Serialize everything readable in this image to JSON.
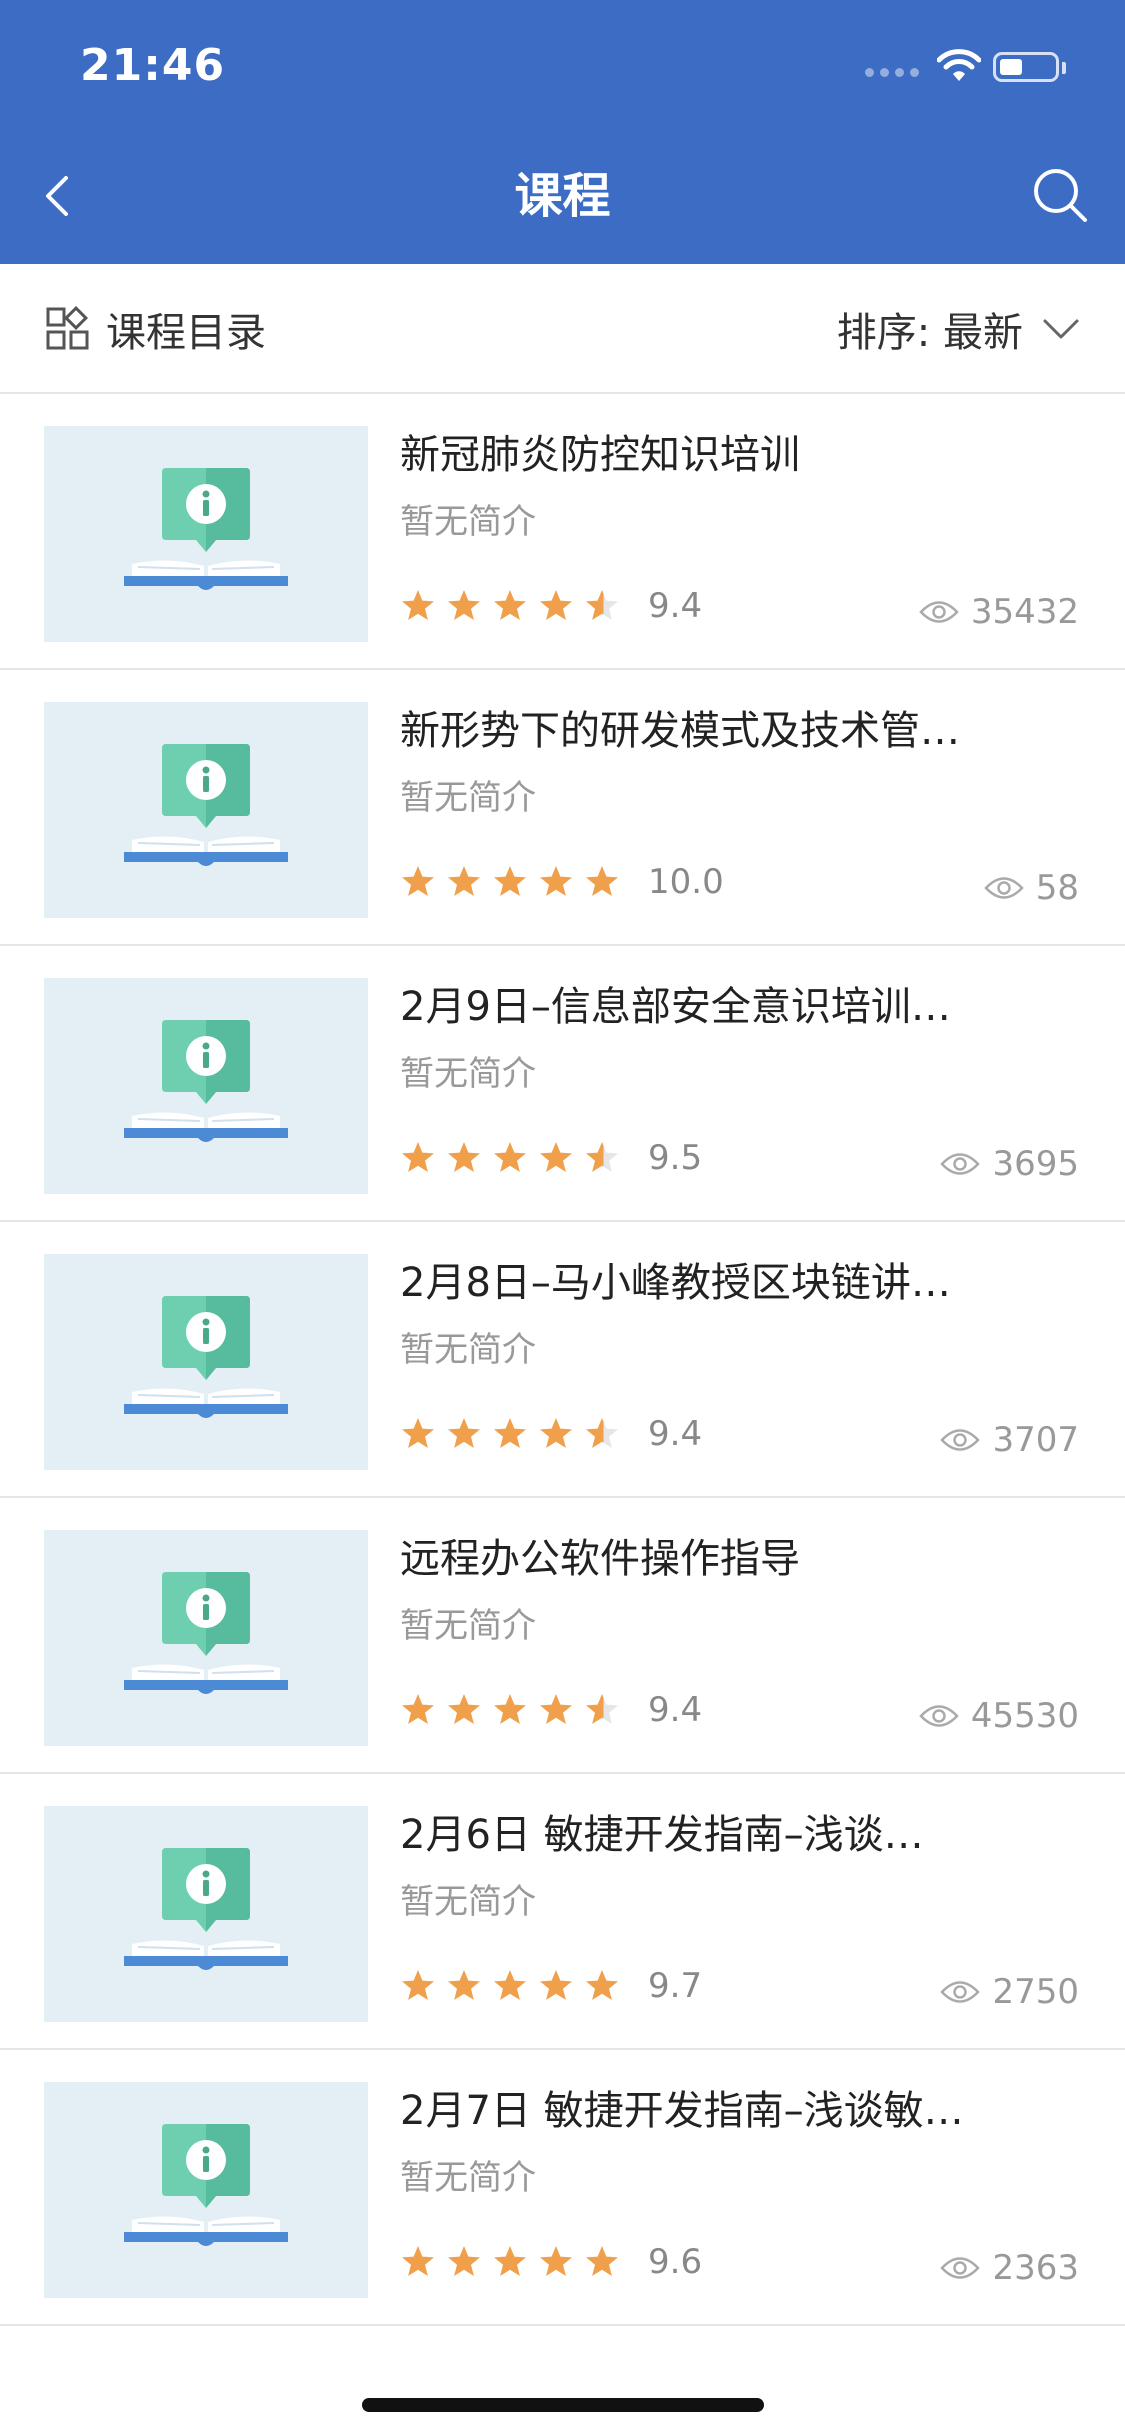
{
  "status_bar": {
    "time": "21:46"
  },
  "header": {
    "title": "课程"
  },
  "filter_bar": {
    "catalog_label": "课程目录",
    "sort_label": "排序: 最新"
  },
  "colors": {
    "header_bg": "#3c6cc4",
    "star": "#f0a04b",
    "thumb_bg": "#e4eef5"
  },
  "courses": [
    {
      "title": "新冠肺炎防控知识培训",
      "description": "暂无简介",
      "rating": "9.4",
      "stars": 4.5,
      "views": "35432"
    },
    {
      "title": "新形势下的研发模式及技术管…",
      "description": "暂无简介",
      "rating": "10.0",
      "stars": 5,
      "views": "58"
    },
    {
      "title": "2月9日–信息部安全意识培训…",
      "description": "暂无简介",
      "rating": "9.5",
      "stars": 4.5,
      "views": "3695"
    },
    {
      "title": "2月8日–马小峰教授区块链讲…",
      "description": "暂无简介",
      "rating": "9.4",
      "stars": 4.5,
      "views": "3707"
    },
    {
      "title": "远程办公软件操作指导",
      "description": "暂无简介",
      "rating": "9.4",
      "stars": 4.5,
      "views": "45530"
    },
    {
      "title": "2月6日 敏捷开发指南–浅谈…",
      "description": "暂无简介",
      "rating": "9.7",
      "stars": 5,
      "views": "2750"
    },
    {
      "title": "2月7日 敏捷开发指南–浅谈敏…",
      "description": "暂无简介",
      "rating": "9.6",
      "stars": 5,
      "views": "2363"
    }
  ]
}
